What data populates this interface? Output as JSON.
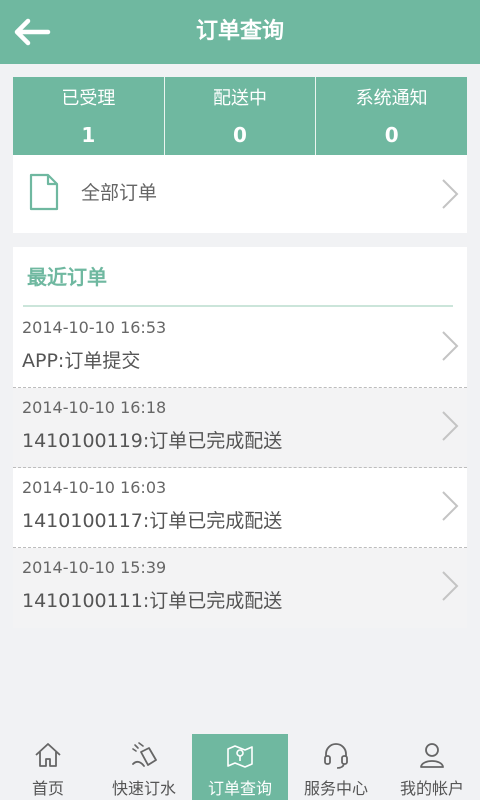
{
  "header": {
    "title": "订单查询"
  },
  "stats": [
    {
      "label": "已受理",
      "count": "1"
    },
    {
      "label": "配送中",
      "count": "0"
    },
    {
      "label": "系统通知",
      "count": "0"
    }
  ],
  "all_orders": {
    "label": "全部订单"
  },
  "recent": {
    "heading": "最近订单",
    "rows": [
      {
        "time": "2014-10-10 16:53",
        "desc": "APP:订单提交"
      },
      {
        "time": "2014-10-10 16:18",
        "desc": "1410100119:订单已完成配送"
      },
      {
        "time": "2014-10-10 16:03",
        "desc": "1410100117:订单已完成配送"
      },
      {
        "time": "2014-10-10 15:39",
        "desc": "1410100111:订单已完成配送"
      }
    ]
  },
  "tabs": [
    {
      "label": "首页",
      "icon": "home-icon"
    },
    {
      "label": "快速订水",
      "icon": "water-order-icon"
    },
    {
      "label": "订单查询",
      "icon": "map-pin-icon",
      "active": true
    },
    {
      "label": "服务中心",
      "icon": "headset-icon"
    },
    {
      "label": "我的帐户",
      "icon": "user-icon"
    }
  ],
  "colors": {
    "accent": "#6fb8a0",
    "background": "#f1f2f4"
  }
}
